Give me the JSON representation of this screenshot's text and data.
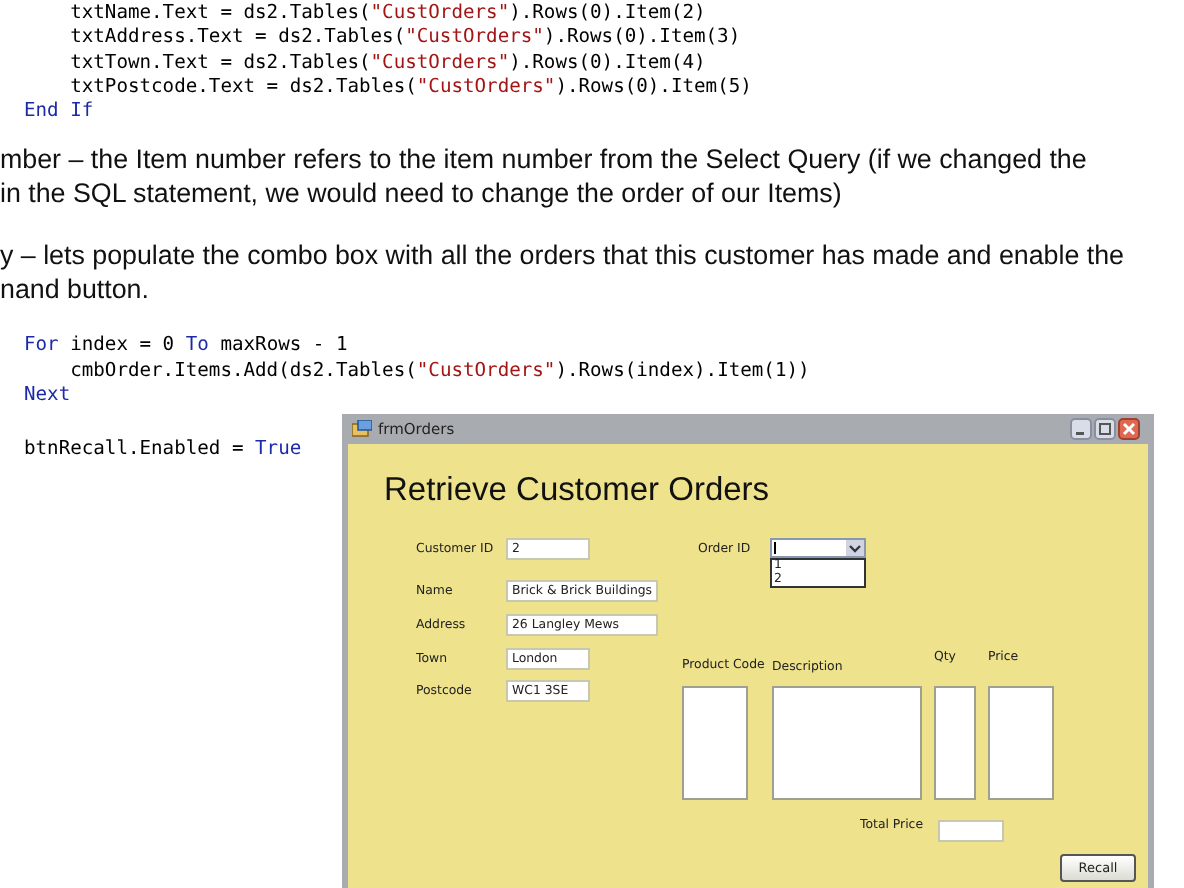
{
  "code_block_1": [
    {
      "tokens": [
        {
          "kind": "plain",
          "text": "    txtName.Text = ds2.Tables("
        },
        {
          "kind": "string",
          "text": "\"CustOrders\""
        },
        {
          "kind": "plain",
          "text": ").Rows(0).Item(2)"
        }
      ]
    },
    {
      "tokens": [
        {
          "kind": "plain",
          "text": "    txtAddress.Text = ds2.Tables("
        },
        {
          "kind": "string",
          "text": "\"CustOrders\""
        },
        {
          "kind": "plain",
          "text": ").Rows(0).Item(3)"
        }
      ]
    },
    {
      "tokens": [
        {
          "kind": "plain",
          "text": "    txtTown.Text = ds2.Tables("
        },
        {
          "kind": "string",
          "text": "\"CustOrders\""
        },
        {
          "kind": "plain",
          "text": ").Rows(0).Item(4)"
        }
      ]
    },
    {
      "tokens": [
        {
          "kind": "plain",
          "text": "    txtPostcode.Text = ds2.Tables("
        },
        {
          "kind": "string",
          "text": "\"CustOrders\""
        },
        {
          "kind": "plain",
          "text": ").Rows(0).Item(5)"
        }
      ]
    },
    {
      "tokens": [
        {
          "kind": "keyword",
          "text": "End If"
        }
      ]
    }
  ],
  "paragraphs": [
    {
      "lines": [
        "mber – the Item number refers to the item number from the Select Query (if we changed the",
        "in the SQL statement, we would need to change the order of our Items)"
      ]
    },
    {
      "lines": [
        "y – lets populate the combo box with all the orders that this customer has made and enable the",
        "nand button."
      ]
    }
  ],
  "code_block_2": [
    {
      "tokens": [
        {
          "kind": "keyword",
          "text": "For"
        },
        {
          "kind": "plain",
          "text": " index = 0 "
        },
        {
          "kind": "keyword",
          "text": "To"
        },
        {
          "kind": "plain",
          "text": " maxRows - 1"
        }
      ]
    },
    {
      "tokens": [
        {
          "kind": "plain",
          "text": "    cmbOrder.Items.Add(ds2.Tables("
        },
        {
          "kind": "string",
          "text": "\"CustOrders\""
        },
        {
          "kind": "plain",
          "text": ").Rows(index).Item(1))"
        }
      ]
    },
    {
      "tokens": [
        {
          "kind": "keyword",
          "text": "Next"
        }
      ]
    }
  ],
  "code_block_3": [
    {
      "tokens": [
        {
          "kind": "plain",
          "text": "btnRecall.Enabled = "
        },
        {
          "kind": "keyword",
          "text": "True"
        }
      ]
    }
  ],
  "window": {
    "title": "frmOrders",
    "heading": "Retrieve Customer Orders",
    "fields": [
      {
        "label": "Customer ID",
        "value": "2"
      },
      {
        "label": "Name",
        "value": "Brick & Brick Buildings"
      },
      {
        "label": "Address",
        "value": "26 Langley Mews"
      },
      {
        "label": "Town",
        "value": "London"
      },
      {
        "label": "Postcode",
        "value": "WC1 3SE"
      }
    ],
    "order_id": {
      "label": "Order ID",
      "options": [
        "1",
        "2"
      ]
    },
    "columns": [
      {
        "label": "Product Code"
      },
      {
        "label": "Description"
      },
      {
        "label": "Qty"
      },
      {
        "label": "Price"
      }
    ],
    "total_price": {
      "label": "Total Price"
    },
    "button": "Recall"
  }
}
